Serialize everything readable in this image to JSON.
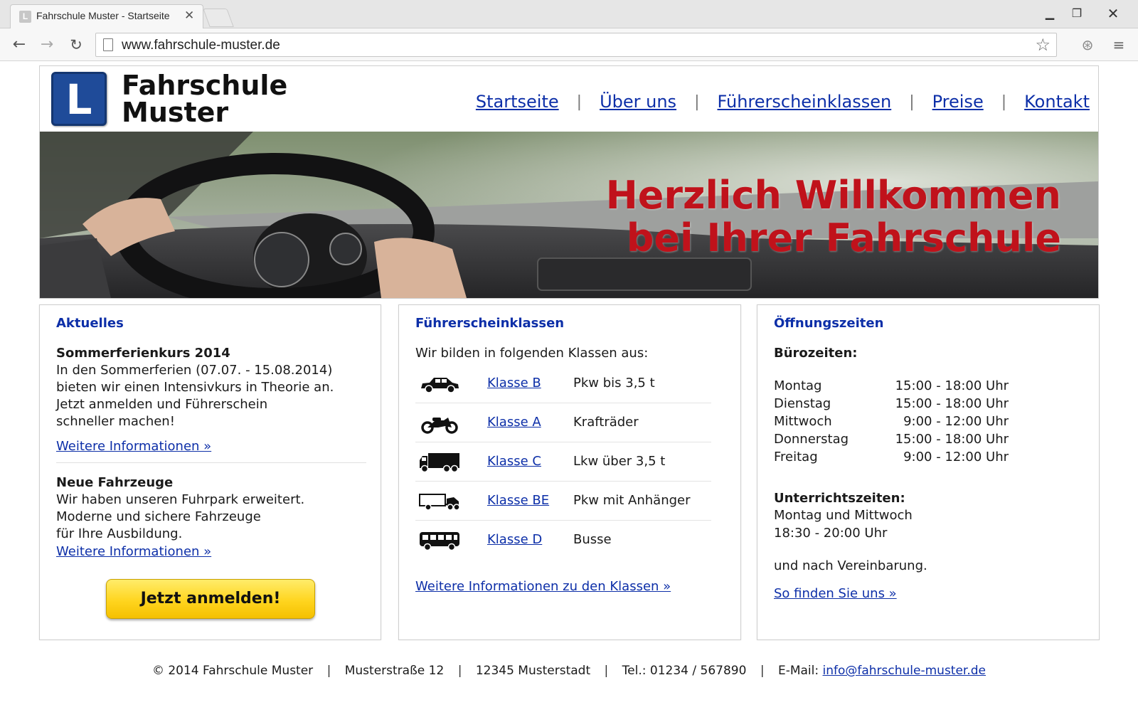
{
  "browser": {
    "tab_title": "Fahrschule Muster - Startseite",
    "tab_favicon": "L",
    "tab_close": "✕",
    "url": "www.fahrschule-muster.de",
    "icons": {
      "back": "back-arrow-icon",
      "forward": "forward-arrow-icon",
      "reload": "reload-icon",
      "page": "page-icon",
      "bookmark": "star-icon",
      "extension": "extension-icon",
      "menu": "hamburger-menu-icon"
    }
  },
  "header": {
    "logo_letter": "L",
    "brand_line1": "Fahrschule",
    "brand_line2": "Muster",
    "nav": [
      "Startseite",
      "Über uns",
      "Führerscheinklassen",
      "Preise",
      "Kontakt"
    ],
    "nav_separator": "|"
  },
  "hero": {
    "line1": "Herzlich Willkommen",
    "line2": "bei Ihrer Fahrschule"
  },
  "news": {
    "title": "Aktuelles",
    "item1_title": "Sommerferienkurs 2014",
    "item1_line1": "In den Sommerferien (07.07. - 15.08.2014)",
    "item1_line2": "bieten wir einen Intensivkurs in Theorie an.",
    "item1_line3": "Jetzt anmelden und Führerschein",
    "item1_line4": "schneller machen!",
    "item1_link": "Weitere Informationen »",
    "item2_title": "Neue Fahrzeuge",
    "item2_line1": "Wir haben unseren Fuhrpark erweitert.",
    "item2_line2": "Moderne und sichere Fahrzeuge",
    "item2_line3": "für Ihre Ausbildung.",
    "item2_link": "Weitere Informationen »",
    "button": "Jetzt anmelden!"
  },
  "classes": {
    "title": "Führerscheinklassen",
    "intro": "Wir bilden in folgenden Klassen aus:",
    "items": [
      {
        "icon": "car-icon",
        "label": "Klasse B",
        "desc": "Pkw bis 3,5 t"
      },
      {
        "icon": "motorcycle-icon",
        "label": "Klasse A",
        "desc": "Krafträder"
      },
      {
        "icon": "truck-icon",
        "label": "Klasse C",
        "desc": "Lkw über 3,5 t"
      },
      {
        "icon": "trailer-icon",
        "label": "Klasse BE",
        "desc": "Pkw mit Anhänger"
      },
      {
        "icon": "bus-icon",
        "label": "Klasse D",
        "desc": "Busse"
      }
    ],
    "link": "Weitere Informationen zu den Klassen »"
  },
  "hours": {
    "title": "Öffnungszeiten",
    "office_title": "Bürozeiten:",
    "rows": [
      {
        "day": "Montag",
        "time": "15:00 - 18:00 Uhr"
      },
      {
        "day": "Dienstag",
        "time": "15:00 - 18:00 Uhr"
      },
      {
        "day": "Mittwoch",
        "time": "9:00 - 12:00 Uhr"
      },
      {
        "day": "Donnerstag",
        "time": "15:00 - 18:00 Uhr"
      },
      {
        "day": "Freitag",
        "time": "9:00 - 12:00 Uhr"
      }
    ],
    "lesson_title": "Unterrichtszeiten:",
    "lesson_days": "Montag und Mittwoch",
    "lesson_time": "18:30 - 20:00 Uhr",
    "appointment": "und nach Vereinbarung.",
    "link": "So finden Sie uns »"
  },
  "footer": {
    "copyright": "© 2014 Fahrschule Muster",
    "street": "Musterstraße 12",
    "city": "12345 Musterstadt",
    "phone": "Tel.: 01234 / 567890",
    "email_label": "E-Mail:",
    "email": "info@fahrschule-muster.de",
    "separator": "|"
  },
  "colors": {
    "link": "#0d2fa8",
    "hero_text": "#c0121b",
    "logo": "#1f4b99",
    "button": "#ffd51f"
  }
}
